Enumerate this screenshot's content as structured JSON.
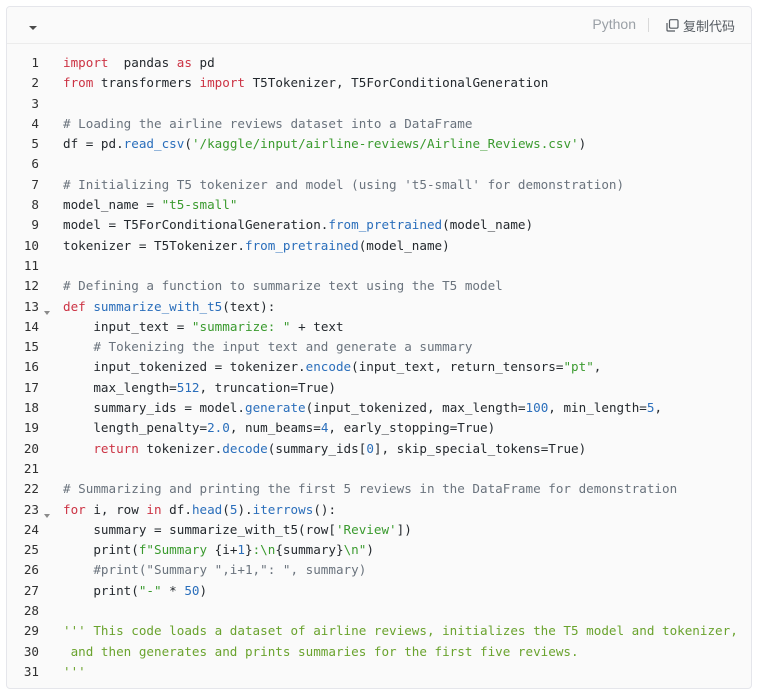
{
  "toolbar": {
    "language": "Python",
    "copy_label": "复制代码",
    "collapse_icon": "chevron-down-icon",
    "copy_icon": "copy-icon"
  },
  "colors": {
    "keyword": "#cc3344",
    "function": "#2a6ebb",
    "string": "#3a9a2e",
    "comment": "#6a737d",
    "number": "#2a6ebb",
    "docstring": "#6aa32e",
    "text": "#24292e"
  },
  "foldable_lines": [
    13,
    23
  ],
  "code_lines": [
    [
      [
        "kw",
        "import"
      ],
      [
        "",
        "  pandas "
      ],
      [
        "kw",
        "as"
      ],
      [
        "",
        " pd"
      ]
    ],
    [
      [
        "kw",
        "from"
      ],
      [
        "",
        " transformers "
      ],
      [
        "kw",
        "import"
      ],
      [
        "",
        " T5Tokenizer, T5ForConditionalGeneration"
      ]
    ],
    [],
    [
      [
        "cm",
        "# Loading the airline reviews dataset into a DataFrame"
      ]
    ],
    [
      [
        "",
        "df = pd."
      ],
      [
        "fn",
        "read_csv"
      ],
      [
        "",
        "("
      ],
      [
        "st",
        "'/kaggle/input/airline-reviews/Airline_Reviews.csv'"
      ],
      [
        "",
        ")"
      ]
    ],
    [],
    [
      [
        "cm",
        "# Initializing T5 tokenizer and model (using 't5-small' for demonstration)"
      ]
    ],
    [
      [
        "",
        "model_name = "
      ],
      [
        "st",
        "\"t5-small\""
      ]
    ],
    [
      [
        "",
        "model = T5ForConditionalGeneration."
      ],
      [
        "fn",
        "from_pretrained"
      ],
      [
        "",
        "(model_name)"
      ]
    ],
    [
      [
        "",
        "tokenizer = T5Tokenizer."
      ],
      [
        "fn",
        "from_pretrained"
      ],
      [
        "",
        "(model_name)"
      ]
    ],
    [],
    [
      [
        "cm",
        "# Defining a function to summarize text using the T5 model"
      ]
    ],
    [
      [
        "kw",
        "def"
      ],
      [
        "",
        " "
      ],
      [
        "fn",
        "summarize_with_t5"
      ],
      [
        "",
        "(text):"
      ]
    ],
    [
      [
        "",
        "    input_text = "
      ],
      [
        "st",
        "\"summarize: \""
      ],
      [
        "",
        " + text"
      ]
    ],
    [
      [
        "cm",
        "    # Tokenizing the input text and generate a summary"
      ]
    ],
    [
      [
        "",
        "    input_tokenized = tokenizer."
      ],
      [
        "fn",
        "encode"
      ],
      [
        "",
        "(input_text, return_tensors="
      ],
      [
        "st",
        "\"pt\""
      ],
      [
        "",
        ","
      ]
    ],
    [
      [
        "",
        "    max_length="
      ],
      [
        "nm",
        "512"
      ],
      [
        "",
        ", truncation=True)"
      ]
    ],
    [
      [
        "",
        "    summary_ids = model."
      ],
      [
        "fn",
        "generate"
      ],
      [
        "",
        "(input_tokenized, max_length="
      ],
      [
        "nm",
        "100"
      ],
      [
        "",
        ", min_length="
      ],
      [
        "nm",
        "5"
      ],
      [
        "",
        ","
      ]
    ],
    [
      [
        "",
        "    length_penalty="
      ],
      [
        "nm",
        "2.0"
      ],
      [
        "",
        ", num_beams="
      ],
      [
        "nm",
        "4"
      ],
      [
        "",
        ", early_stopping=True)"
      ]
    ],
    [
      [
        "kw",
        "    return"
      ],
      [
        "",
        " tokenizer."
      ],
      [
        "fn",
        "decode"
      ],
      [
        "",
        "(summary_ids["
      ],
      [
        "nm",
        "0"
      ],
      [
        "",
        "], skip_special_tokens=True)"
      ]
    ],
    [],
    [
      [
        "cm",
        "# Summarizing and printing the first 5 reviews in the DataFrame for demonstration"
      ]
    ],
    [
      [
        "kw",
        "for"
      ],
      [
        "",
        " i, row "
      ],
      [
        "kw",
        "in"
      ],
      [
        "",
        " df."
      ],
      [
        "fn",
        "head"
      ],
      [
        "",
        "("
      ],
      [
        "nm",
        "5"
      ],
      [
        "",
        ")."
      ],
      [
        "fn",
        "iterrows"
      ],
      [
        "",
        "():"
      ]
    ],
    [
      [
        "",
        "    summary = summarize_with_t5(row["
      ],
      [
        "st",
        "'Review'"
      ],
      [
        "",
        "])"
      ]
    ],
    [
      [
        "",
        "    print("
      ],
      [
        "st",
        "f\"Summary "
      ],
      [
        "",
        "{i+"
      ],
      [
        "nm",
        "1"
      ],
      [
        "",
        "}"
      ],
      [
        "st",
        ":\\n"
      ],
      [
        "",
        "{summary}"
      ],
      [
        "st",
        "\\n\""
      ],
      [
        "",
        ")"
      ]
    ],
    [
      [
        "cm",
        "    #print(\"Summary \",i+1,\": \", summary)"
      ]
    ],
    [
      [
        "",
        "    print("
      ],
      [
        "st",
        "\"-\""
      ],
      [
        "",
        " * "
      ],
      [
        "nm",
        "50"
      ],
      [
        "",
        ")"
      ]
    ],
    [],
    [
      [
        "dc",
        "''' This code loads a dataset of airline reviews, initializes the T5 model and tokenizer,"
      ]
    ],
    [
      [
        "dc",
        " and then generates and prints summaries for the first five reviews."
      ]
    ],
    [
      [
        "dc",
        "'''"
      ]
    ]
  ]
}
